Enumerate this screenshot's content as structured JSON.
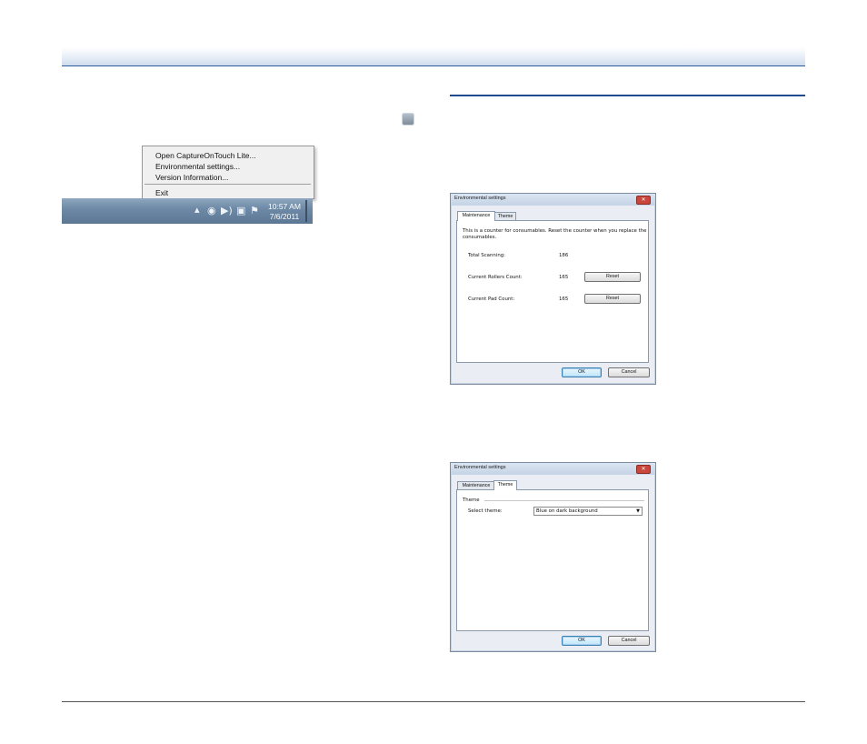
{
  "context_menu": {
    "items": [
      "Open CaptureOnTouch Lite...",
      "Environmental settings...",
      "Version Information..."
    ],
    "exit_label": "Exit"
  },
  "taskbar": {
    "time": "10:57 AM",
    "date": "7/6/2011",
    "tray_icons": [
      "show-hidden-icon",
      "captureontouch-icon",
      "volume-icon",
      "network-icon",
      "action-center-flag-icon"
    ]
  },
  "dialog1": {
    "title": "Environmental settings",
    "tabs": [
      "Maintenance",
      "Theme"
    ],
    "active_tab": "Maintenance",
    "description": "This is a counter for consumables. Reset the counter when you replace the consumables.",
    "rows": [
      {
        "label": "Total Scanning:",
        "value": "186"
      },
      {
        "label": "Current Rollers Count:",
        "value": "165",
        "button": "Reset"
      },
      {
        "label": "Current Pad Count:",
        "value": "165",
        "button": "Reset"
      }
    ],
    "ok_label": "OK",
    "cancel_label": "Cancel"
  },
  "dialog2": {
    "title": "Environmental settings",
    "tabs": [
      "Maintenance",
      "Theme"
    ],
    "active_tab": "Theme",
    "group_label": "Theme",
    "select_label": "Select theme:",
    "select_value": "Blue on dark background",
    "ok_label": "OK",
    "cancel_label": "Cancel"
  }
}
